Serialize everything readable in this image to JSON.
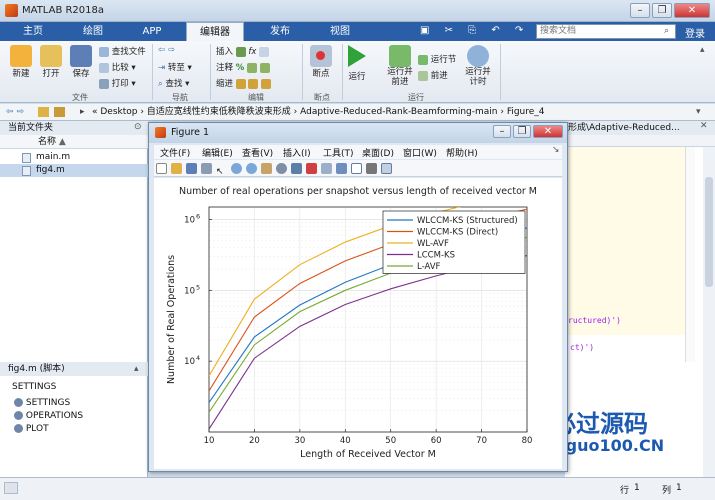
{
  "window": {
    "title": "MATLAB R2018a",
    "controls": [
      "–",
      "❐",
      "✕"
    ]
  },
  "tabs": [
    {
      "label": "主页",
      "active": false
    },
    {
      "label": "绘图",
      "active": false
    },
    {
      "label": "APP",
      "active": false
    },
    {
      "label": "编辑器",
      "active": true
    },
    {
      "label": "发布",
      "active": false
    },
    {
      "label": "视图",
      "active": false
    }
  ],
  "search": {
    "placeholder": "搜索文档"
  },
  "login": "登录",
  "ribbon": {
    "file": {
      "new": "新建",
      "open": "打开",
      "save": "保存",
      "find_files": "查找文件",
      "compare": "比较",
      "print": "打印",
      "group": "文件"
    },
    "nav": {
      "goto": "转至",
      "find": "查找",
      "group": "导航"
    },
    "edit": {
      "insert": "插入",
      "comment": "注释",
      "indent": "缩进",
      "fx": "fx",
      "group": "编辑"
    },
    "breakpoints": {
      "label": "断点",
      "group": "断点"
    },
    "run": {
      "run": "运行",
      "run_advance": "运行并\n前进",
      "run_section": "运行节",
      "advance": "前进",
      "run_time": "运行并\n计时",
      "group": "运行"
    }
  },
  "address": {
    "path": "« Desktop  ›  自适应宽线性约束低秩降秩波束形成  ›  Adaptive-Reduced-Rank-Beamforming-main  ›  Figure_4"
  },
  "current_folder": {
    "title": "当前文件夹",
    "column": "名称",
    "sort_arrow": "▲",
    "files": [
      {
        "name": "main.m",
        "selected": false
      },
      {
        "name": "fig4.m",
        "selected": true
      }
    ]
  },
  "details": {
    "title": "fig4.m  (脚本)",
    "heading": "SETTINGS",
    "items": [
      "SETTINGS",
      "OPERATIONS",
      "PLOT"
    ]
  },
  "editor": {
    "path_fragment": "形成\\Adaptive-Reduced...",
    "code_lines": [
      "ructured)')",
      "ct)')"
    ]
  },
  "statusbar": {
    "row_label": "行",
    "row": "1",
    "col_label": "列",
    "col": "1"
  },
  "watermark": {
    "text1": "必过源码",
    "text2": "Biguo100.CN"
  },
  "figure": {
    "title": "Figure 1",
    "menu": [
      "文件(F)",
      "编辑(E)",
      "查看(V)",
      "插入(I)",
      "工具(T)",
      "桌面(D)",
      "窗口(W)",
      "帮助(H)"
    ]
  },
  "colors": {
    "tabbar": "#2a5ea6",
    "accent": "#2a5ea6"
  },
  "chart_data": {
    "type": "line",
    "title": "Number of real operations per snapshot versus length of received vector M",
    "xlabel": "Length of Received Vector M",
    "ylabel": "Number of Real Operations",
    "x": [
      10,
      20,
      30,
      40,
      50,
      60,
      70,
      80
    ],
    "xlim": [
      10,
      80
    ],
    "ylim": [
      1000,
      1500000
    ],
    "yscale": "log",
    "x_ticks": [
      "10",
      "20",
      "30",
      "40",
      "50",
      "60",
      "70",
      "80"
    ],
    "y_ticks": [
      {
        "base": "10",
        "exp": "4",
        "value": 10000
      },
      {
        "base": "10",
        "exp": "5",
        "value": 100000
      },
      {
        "base": "10",
        "exp": "6",
        "value": 1000000
      }
    ],
    "grid": true,
    "legend_position": "top-right",
    "series": [
      {
        "name": "WLCCM-KS (Structured)",
        "color": "#1f77c4",
        "values": [
          2600,
          22000,
          62000,
          130000,
          230000,
          370000,
          540000,
          760000
        ]
      },
      {
        "name": "WLCCM-KS (Direct)",
        "color": "#d95319",
        "values": [
          3800,
          42000,
          125000,
          260000,
          450000,
          700000,
          1000000,
          1400000
        ]
      },
      {
        "name": "WL-AVF",
        "color": "#edb120",
        "values": [
          6200,
          75000,
          230000,
          480000,
          820000,
          1250000,
          1800000,
          2500000
        ]
      },
      {
        "name": "LCCM-KS",
        "color": "#7e2f8e",
        "values": [
          1100,
          11000,
          31000,
          63000,
          105000,
          160000,
          230000,
          310000
        ]
      },
      {
        "name": "L-AVF",
        "color": "#77ac30",
        "values": [
          1900,
          17000,
          50000,
          100000,
          175000,
          275000,
          400000,
          560000
        ]
      }
    ]
  }
}
